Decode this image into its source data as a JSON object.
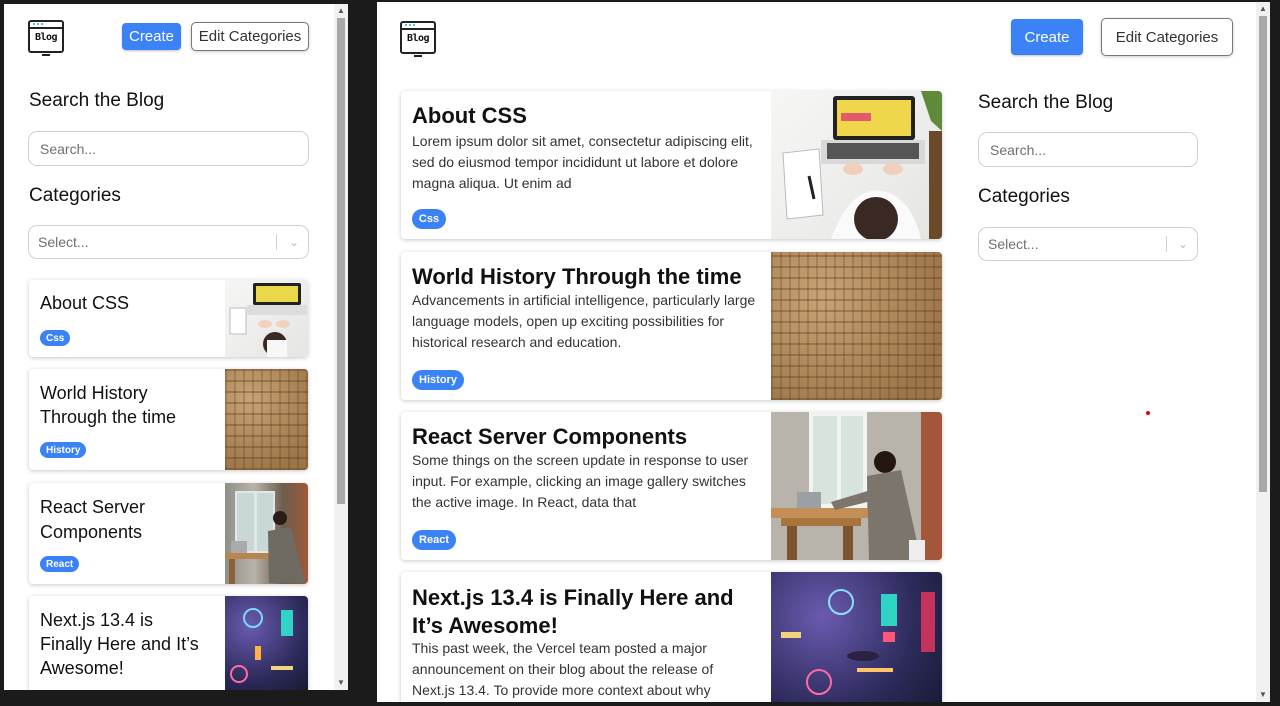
{
  "colors": {
    "accent": "#3b82f6",
    "scroll_thumb": "#a8a8a8"
  },
  "header": {
    "logo_text": "Blog",
    "create_label": "Create",
    "edit_categories_label": "Edit Categories"
  },
  "sidebar": {
    "search_heading": "Search the Blog",
    "search_placeholder": "Search...",
    "categories_heading": "Categories",
    "select_placeholder": "Select..."
  },
  "posts": [
    {
      "title": "About CSS",
      "excerpt": "Lorem ipsum dolor sit amet, consectetur adipiscing elit, sed do eiusmod tempor incididunt ut labore et dolore magna aliqua. Ut enim ad",
      "tag": "Css",
      "image": "laptop-desk-image"
    },
    {
      "title": "World History Through the time",
      "excerpt": "Advancements in artificial intelligence, particularly large language models, open up exciting possibilities for historical research and education.",
      "tag": "History",
      "image": "hieroglyphs-image"
    },
    {
      "title": "React Server Components",
      "excerpt": "Some things on the screen update in response to user input. For example, clicking an image gallery switches the active image. In React, data that",
      "tag": "React",
      "image": "man-at-laptop-image"
    },
    {
      "title": "Next.js 13.4 is Finally Here and It’s Awesome!",
      "excerpt": "This past week, the Vercel team posted a major announcement on their blog about the release of Next.js 13.4. To provide more context about why",
      "tag": "",
      "image": "neon-street-image"
    }
  ]
}
